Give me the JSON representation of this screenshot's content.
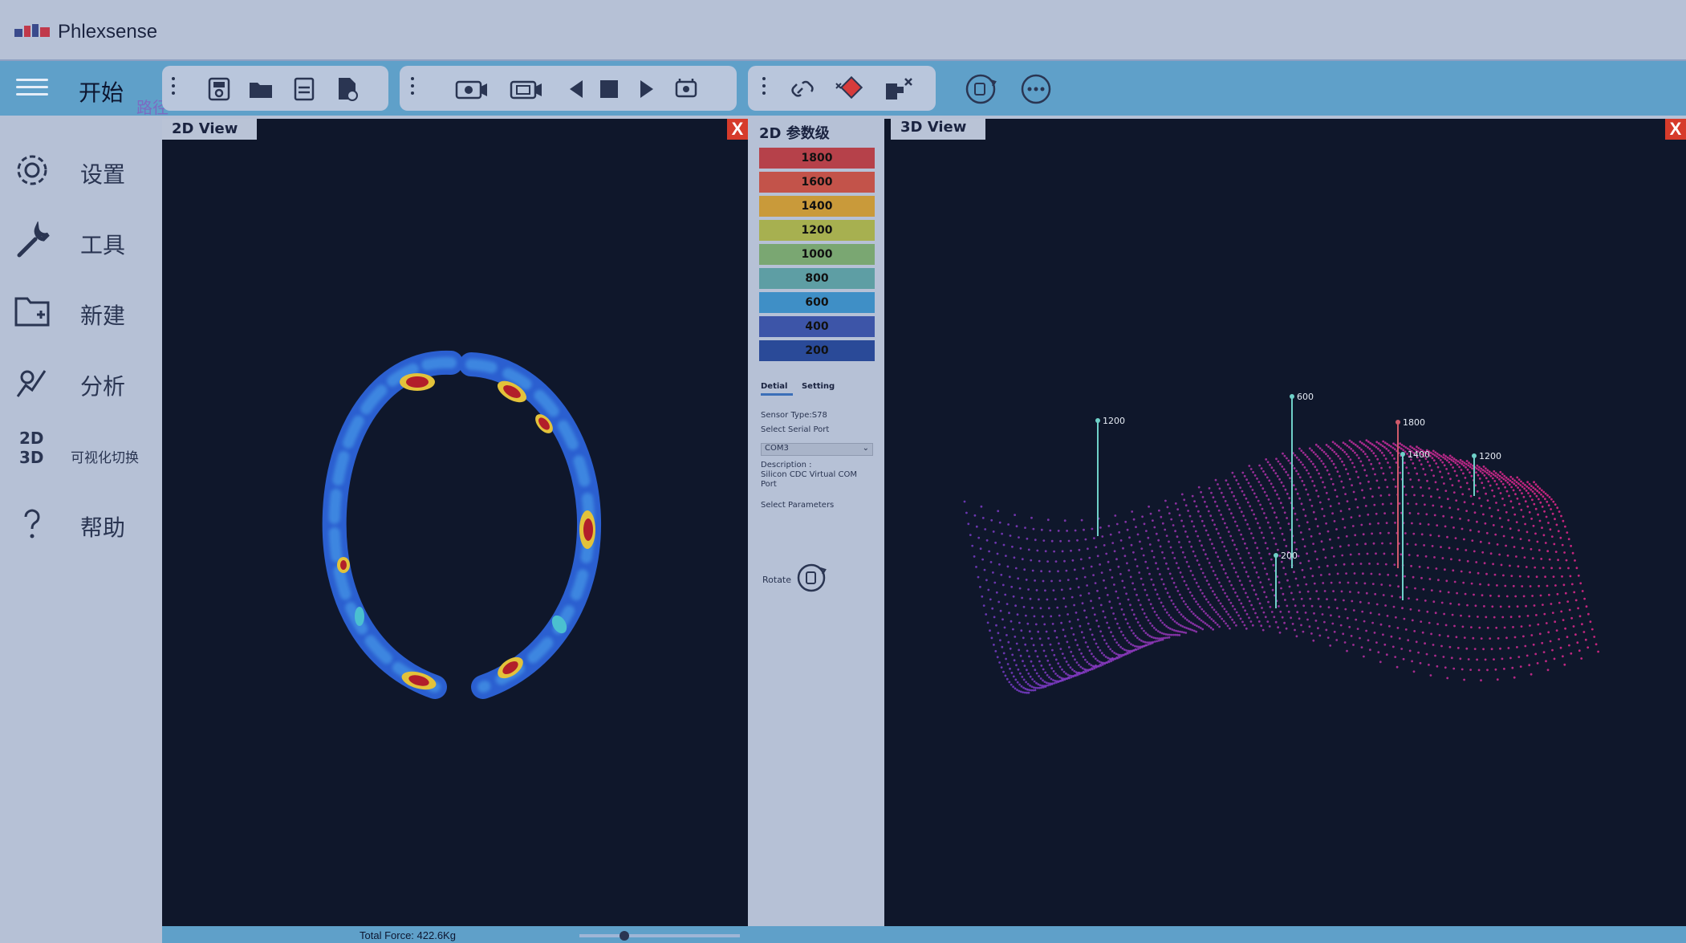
{
  "app": {
    "title": "Phlexsense"
  },
  "ribbon": {
    "start_label": "开始",
    "path_label": "路径",
    "buttons": [
      "save-icon",
      "open-folder-icon",
      "floppy-icon",
      "export-file-icon",
      "record-camera-icon",
      "video-playback-icon",
      "prev-frame-icon",
      "stop-icon",
      "play-icon",
      "snapshot-icon",
      "link-icon",
      "calibrate-icon",
      "disconnect-icon",
      "rotate-icon",
      "more-icon"
    ]
  },
  "sidebar": {
    "items": [
      {
        "label": "设置",
        "icon": "gear-icon"
      },
      {
        "label": "工具",
        "icon": "wrench-icon"
      },
      {
        "label": "新建",
        "icon": "new-folder-icon"
      },
      {
        "label": "分析",
        "icon": "analysis-icon"
      },
      {
        "label": "可视化切换",
        "icon": "2d-3d-switch-icon",
        "icon_text_top": "2D",
        "icon_text_bottom": "3D"
      },
      {
        "label": "帮助",
        "icon": "help-icon"
      }
    ]
  },
  "view2d": {
    "tab_label": "2D View",
    "close_label": "X"
  },
  "params": {
    "title": "2D 参数级",
    "legend": [
      {
        "value": "1800",
        "color": "#b6414a"
      },
      {
        "value": "1600",
        "color": "#c3534a"
      },
      {
        "value": "1400",
        "color": "#c99a3a"
      },
      {
        "value": "1200",
        "color": "#a7b050"
      },
      {
        "value": "1000",
        "color": "#7aa772"
      },
      {
        "value": "800",
        "color": "#5e9ea4"
      },
      {
        "value": "600",
        "color": "#3f8fc6"
      },
      {
        "value": "400",
        "color": "#3d55a8"
      },
      {
        "value": "200",
        "color": "#2a4a98"
      }
    ],
    "tab_detail": "Detial",
    "tab_setting": "Setting",
    "sensor_type": "Sensor Type:S78",
    "select_serial": "Select Serial Port",
    "com_value": "COM3",
    "description_label": "Description :",
    "description_value": "Silicon CDC Virtual COM Port",
    "select_parameters": "Select Parameters",
    "rotate_label": "Rotate"
  },
  "view3d": {
    "tab_label": "3D View",
    "close_label": "X",
    "markers": [
      "1200",
      "600",
      "1800",
      "1400",
      "1200",
      "200"
    ]
  },
  "statusbar": {
    "total_force": "Total Force: 422.6Kg"
  },
  "colors": {
    "ribbon": "#5fa0c9",
    "panel_bg": "#0f172b",
    "sidebar_bg": "#b6c1d6",
    "close_red": "#d63b2b"
  }
}
